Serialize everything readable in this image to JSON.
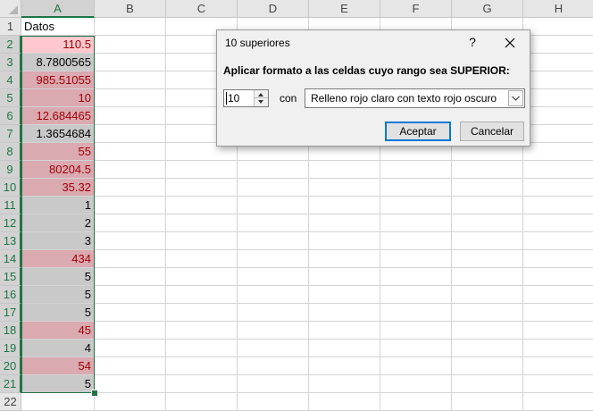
{
  "columns": [
    "A",
    "B",
    "C",
    "D",
    "E",
    "F",
    "G",
    "H"
  ],
  "selected_column": "A",
  "rows": [
    {
      "n": "1",
      "value": "Datos",
      "style": "header"
    },
    {
      "n": "2",
      "value": "110.5",
      "style": "pink-light"
    },
    {
      "n": "3",
      "value": "8.7800565",
      "style": "grey"
    },
    {
      "n": "4",
      "value": "985.51055",
      "style": "pink"
    },
    {
      "n": "5",
      "value": "10",
      "style": "pink"
    },
    {
      "n": "6",
      "value": "12.684465",
      "style": "pink"
    },
    {
      "n": "7",
      "value": "1.3654684",
      "style": "grey"
    },
    {
      "n": "8",
      "value": "55",
      "style": "pink"
    },
    {
      "n": "9",
      "value": "80204.5",
      "style": "pink"
    },
    {
      "n": "10",
      "value": "35.32",
      "style": "pink"
    },
    {
      "n": "11",
      "value": "1",
      "style": "grey"
    },
    {
      "n": "12",
      "value": "2",
      "style": "grey"
    },
    {
      "n": "13",
      "value": "3",
      "style": "grey"
    },
    {
      "n": "14",
      "value": "434",
      "style": "pink"
    },
    {
      "n": "15",
      "value": "5",
      "style": "grey"
    },
    {
      "n": "16",
      "value": "5",
      "style": "grey"
    },
    {
      "n": "17",
      "value": "5",
      "style": "grey"
    },
    {
      "n": "18",
      "value": "45",
      "style": "pink"
    },
    {
      "n": "19",
      "value": "4",
      "style": "grey"
    },
    {
      "n": "20",
      "value": "54",
      "style": "pink"
    },
    {
      "n": "21",
      "value": "5",
      "style": "grey"
    },
    {
      "n": "22",
      "value": "",
      "style": "none"
    }
  ],
  "colors": {
    "accent_green": "#217346",
    "light_red_fill": "#ffc7ce",
    "dark_red_text": "#9c0006",
    "dialog_focus_blue": "#0078d7"
  },
  "dialog": {
    "title": "10 superiores",
    "help": "?",
    "close_icon": "close-icon",
    "instruction": "Aplicar formato a las celdas cuyo rango sea SUPERIOR:",
    "count_value": "10",
    "con_label": "con",
    "format_value": "Relleno rojo claro con texto rojo oscuro",
    "ok_label": "Aceptar",
    "cancel_label": "Cancelar"
  }
}
